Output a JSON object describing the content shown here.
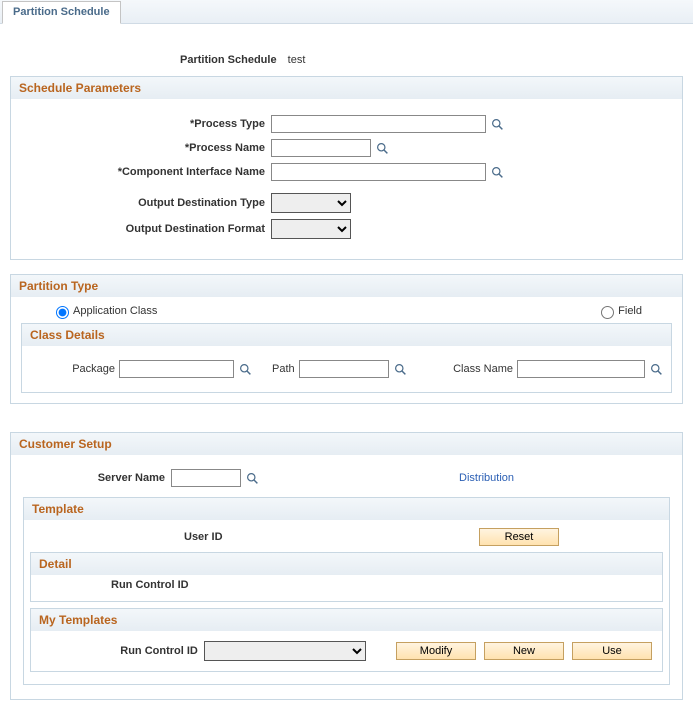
{
  "tab": {
    "label": "Partition Schedule"
  },
  "header": {
    "label": "Partition Schedule",
    "value": "test"
  },
  "schedule_params": {
    "title": "Schedule Parameters",
    "process_type": {
      "label": "*Process Type",
      "value": ""
    },
    "process_name": {
      "label": "*Process Name",
      "value": ""
    },
    "component_interface_name": {
      "label": "*Component Interface Name",
      "value": ""
    },
    "output_dest_type": {
      "label": "Output Destination Type",
      "value": ""
    },
    "output_dest_format": {
      "label": "Output Destination Format",
      "value": ""
    }
  },
  "partition_type": {
    "title": "Partition Type",
    "option_app_class": "Application Class",
    "option_field": "Field",
    "class_details": {
      "title": "Class Details",
      "package": {
        "label": "Package",
        "value": ""
      },
      "path": {
        "label": "Path",
        "value": ""
      },
      "class_name": {
        "label": "Class Name",
        "value": ""
      }
    }
  },
  "customer_setup": {
    "title": "Customer Setup",
    "server_name": {
      "label": "Server Name",
      "value": ""
    },
    "distribution": "Distribution",
    "template": {
      "title": "Template",
      "user_id_label": "User ID",
      "reset": "Reset",
      "detail": {
        "title": "Detail",
        "run_control_id_label": "Run Control ID"
      },
      "my_templates": {
        "title": "My Templates",
        "run_control_id_label": "Run Control ID",
        "run_control_id_value": "",
        "modify": "Modify",
        "new": "New",
        "use": "Use"
      }
    }
  }
}
